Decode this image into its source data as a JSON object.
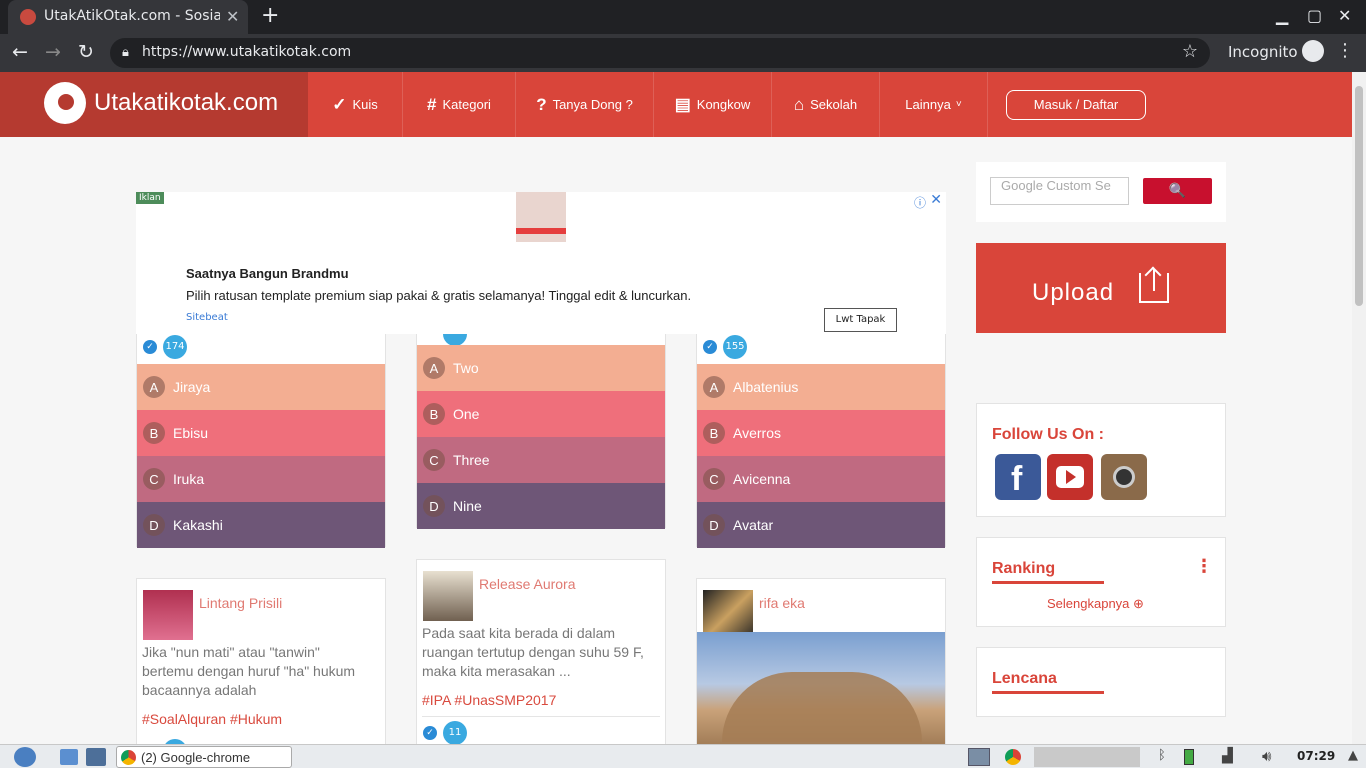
{
  "browser": {
    "tab_title": "UtakAtikOtak.com - Sosia",
    "tab_close": "✕",
    "new_tab": "+",
    "url": "https://www.utakatikotak.com",
    "incognito_label": "Incognito",
    "window_controls": {
      "minimize": "▁",
      "maximize": "▢",
      "close": "✕"
    }
  },
  "site": {
    "logo_text": "Utakatikotak.com",
    "nav": [
      {
        "label": "Kuis",
        "icon": "check-icon"
      },
      {
        "label": "Kategori",
        "icon": "hash-icon"
      },
      {
        "label": "Tanya Dong ?",
        "icon": "question-icon"
      },
      {
        "label": "Kongkow",
        "icon": "newspaper-icon"
      },
      {
        "label": "Sekolah",
        "icon": "school-icon"
      },
      {
        "label": "Lainnya",
        "icon": "chevron-down-icon"
      }
    ],
    "login_label": "Masuk / Daftar",
    "accent_color": "#d9453a"
  },
  "ad": {
    "label": "Iklan",
    "title": "Saatnya Bangun Brandmu",
    "description": "Pilih ratusan template premium siap pakai & gratis selamanya! Tinggal edit & luncurkan.",
    "source": "Sitebeat",
    "cta": "Lwt Tapak"
  },
  "quiz_cards": [
    {
      "count": "174",
      "options": [
        {
          "letter": "A",
          "text": "Jiraya"
        },
        {
          "letter": "B",
          "text": "Ebisu"
        },
        {
          "letter": "C",
          "text": "Iruka"
        },
        {
          "letter": "D",
          "text": "Kakashi"
        }
      ]
    },
    {
      "count": "",
      "options": [
        {
          "letter": "A",
          "text": "Two"
        },
        {
          "letter": "B",
          "text": "One"
        },
        {
          "letter": "C",
          "text": "Three"
        },
        {
          "letter": "D",
          "text": "Nine"
        }
      ]
    },
    {
      "count": "155",
      "options": [
        {
          "letter": "A",
          "text": "Albatenius"
        },
        {
          "letter": "B",
          "text": "Averros"
        },
        {
          "letter": "C",
          "text": "Avicenna"
        },
        {
          "letter": "D",
          "text": "Avatar"
        }
      ]
    }
  ],
  "posts": [
    {
      "author": "Lintang Prisili",
      "excerpt": [
        "Jika \"nun mati\" atau \"tanwin\"",
        "bertemu dengan huruf \"ha\" hukum",
        "bacaannya adalah"
      ],
      "tags": "#SoalAlquran #Hukum"
    },
    {
      "author": "Release Aurora",
      "excerpt": [
        "Pada saat kita berada di dalam",
        "ruangan tertutup dengan suhu 59 F,",
        "maka kita merasakan ..."
      ],
      "tags": "#IPA #UnasSMP2017",
      "count": "11"
    },
    {
      "author": "rifa eka"
    }
  ],
  "sidebar": {
    "search_placeholder": "Google Custom Se",
    "search_button": "🔍",
    "upload_label": "Upload",
    "follow_title": "Follow Us On :",
    "social": [
      "facebook-icon",
      "youtube-icon",
      "instagram-icon"
    ],
    "ranking_title": "Ranking",
    "ranking_more": "Selengkapnya ⊕",
    "badge_title": "Lencana"
  },
  "taskbar": {
    "app_label": "(2) Google-chrome",
    "clock": "07:29"
  }
}
